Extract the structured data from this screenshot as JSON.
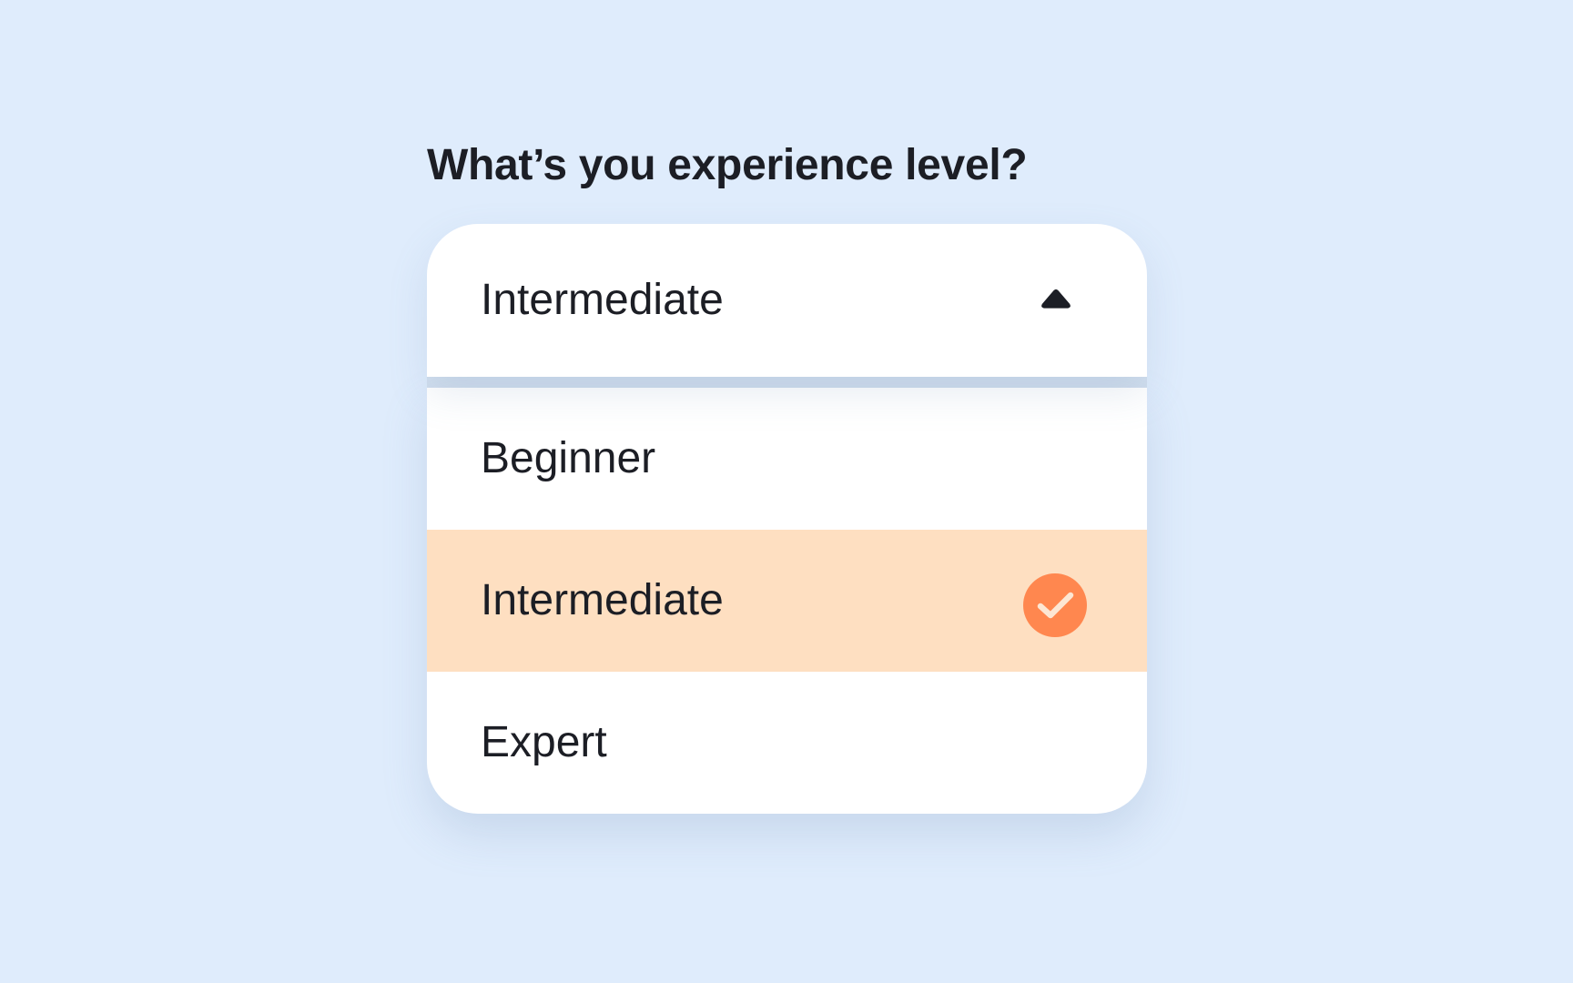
{
  "question": "What’s you experience level?",
  "dropdown": {
    "selected_label": "Intermediate",
    "state": "open",
    "caret_icon": "caret-up-icon",
    "options": [
      {
        "label": "Beginner",
        "selected": false
      },
      {
        "label": "Intermediate",
        "selected": true,
        "icon": "check-circle-icon"
      },
      {
        "label": "Expert",
        "selected": false
      }
    ]
  },
  "colors": {
    "background": "#dfecfc",
    "text": "#1c1e25",
    "selected_row": "#fedfc1",
    "check_accent": "#ff874f",
    "divider": "#d3e0ef"
  }
}
